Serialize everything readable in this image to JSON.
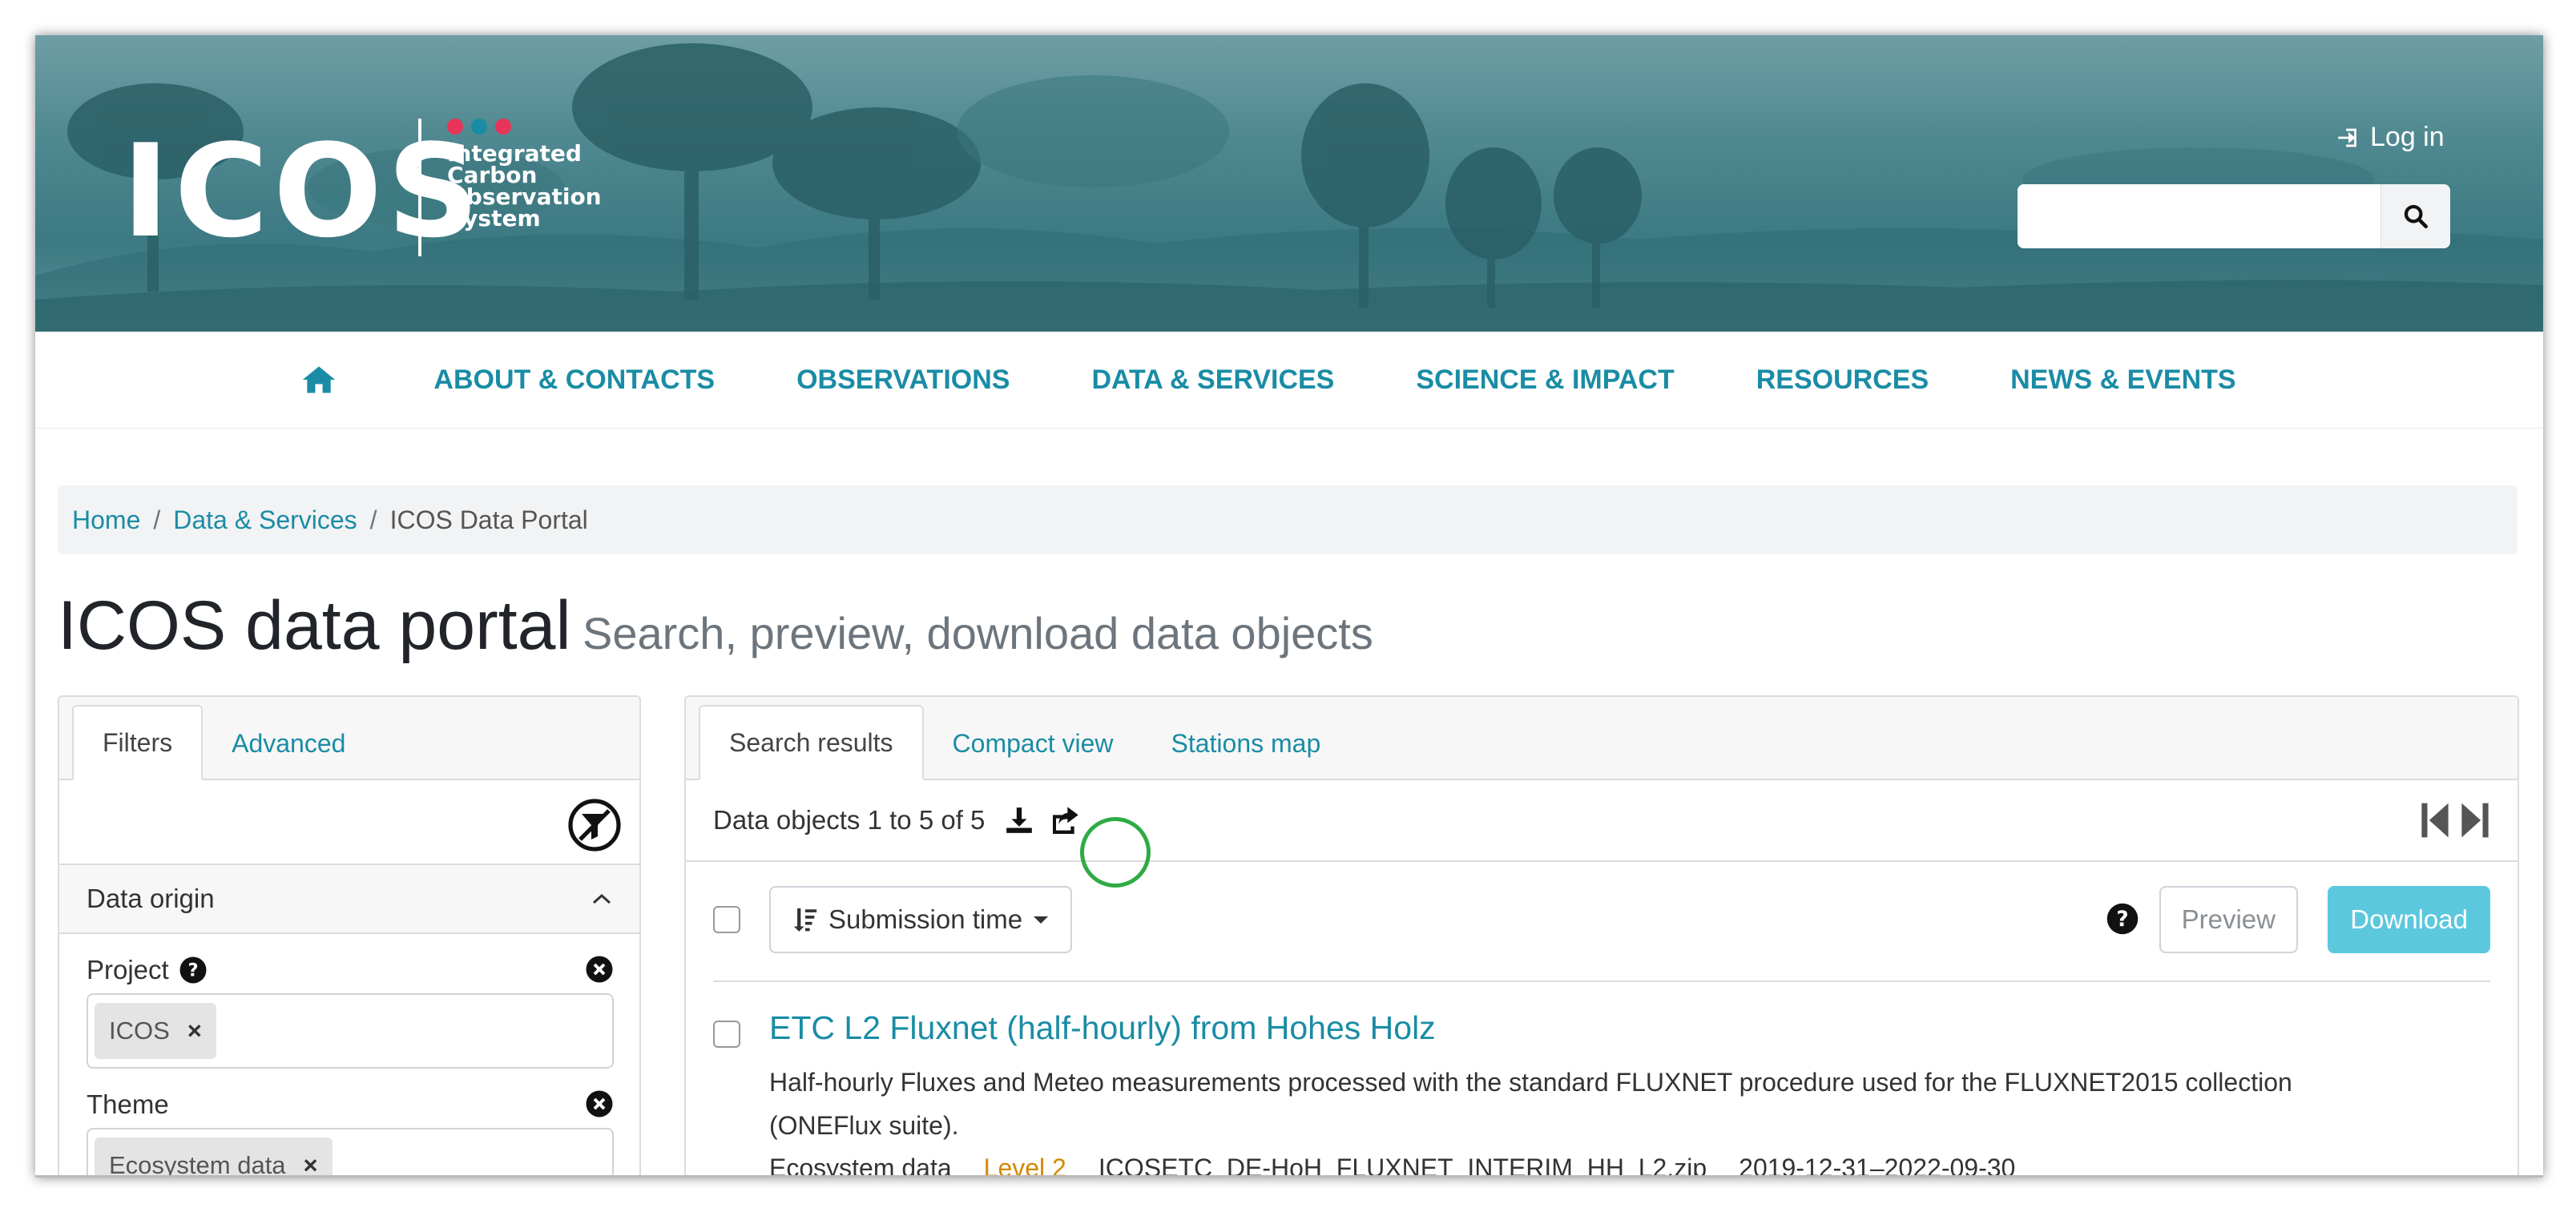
{
  "header": {
    "logo_text": "ICOS",
    "logo_subtitle": [
      "Integrated",
      "Carbon",
      "Observation",
      "System"
    ],
    "logo_dot_colors": [
      "#e8335b",
      "#1a8ca5",
      "#e8335b"
    ],
    "login_label": "Log in",
    "search_placeholder": ""
  },
  "nav": {
    "items": [
      "ABOUT & CONTACTS",
      "OBSERVATIONS",
      "DATA & SERVICES",
      "SCIENCE & IMPACT",
      "RESOURCES",
      "NEWS & EVENTS"
    ]
  },
  "breadcrumb": {
    "home": "Home",
    "data_services": "Data & Services",
    "current": "ICOS Data Portal"
  },
  "page": {
    "title": "ICOS data portal",
    "subtitle": "Search, preview, download data objects"
  },
  "filters": {
    "tabs": [
      "Filters",
      "Advanced"
    ],
    "section_title": "Data origin",
    "project_label": "Project",
    "project_chip": "ICOS",
    "theme_label": "Theme",
    "theme_chip": "Ecosystem data",
    "chip_remove": "×"
  },
  "results": {
    "tabs": [
      "Search results",
      "Compact view",
      "Stations map"
    ],
    "count_text": "Data objects 1 to 5 of 5",
    "sort_label": "Submission time",
    "preview_label": "Preview",
    "download_label": "Download",
    "items": [
      {
        "title": "ETC L2 Fluxnet (half-hourly) from Hohes Holz",
        "description": "Half-hourly Fluxes and Meteo measurements processed with the standard FLUXNET procedure used for the FLUXNET2015 collection (ONEFlux suite).",
        "meta_theme": "Ecosystem data",
        "meta_level": "Level 2",
        "meta_file": "ICOSETC_DE-HoH_FLUXNET_INTERIM_HH_L2.zip",
        "meta_dates": "2019-12-31–2022-09-30"
      }
    ]
  },
  "colors": {
    "accent": "#1a8ca5",
    "download_button": "#5bc8de",
    "highlight_circle": "#2eab43"
  }
}
